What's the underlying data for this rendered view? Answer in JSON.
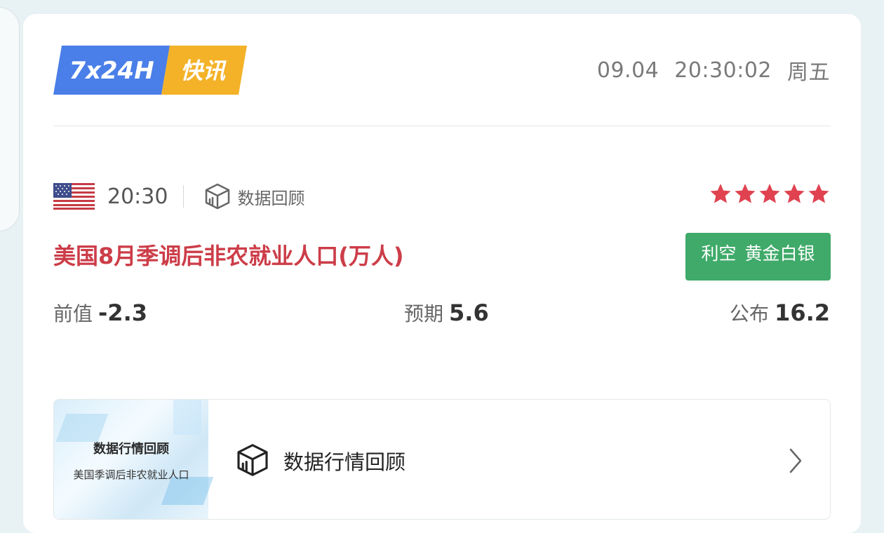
{
  "header": {
    "logo_left": "7x24H",
    "logo_right": "快讯",
    "date": "09.04",
    "time": "20:30:02",
    "weekday": "周五"
  },
  "event": {
    "country_flag": "us-flag-icon",
    "time": "20:30",
    "review_label": "数据回顾",
    "stars": 5,
    "title": "美国8月季调后非农就业人口(万人)",
    "impact": {
      "label": "利空",
      "asset": "黄金白银"
    },
    "previous": {
      "label": "前值",
      "value": "-2.3"
    },
    "expected": {
      "label": "预期",
      "value": "5.6"
    },
    "actual": {
      "label": "公布",
      "value": "16.2"
    }
  },
  "review_card": {
    "thumb_title": "数据行情回顾",
    "thumb_subtitle": "美国季调后非农就业人口",
    "title": "数据行情回顾",
    "icon": "box-chart-icon"
  },
  "colors": {
    "accent_red": "#cc3d48",
    "impact_green": "#3faa69",
    "logo_blue": "#4a7ee8",
    "logo_yellow": "#f4b228",
    "star": "#e04250"
  }
}
